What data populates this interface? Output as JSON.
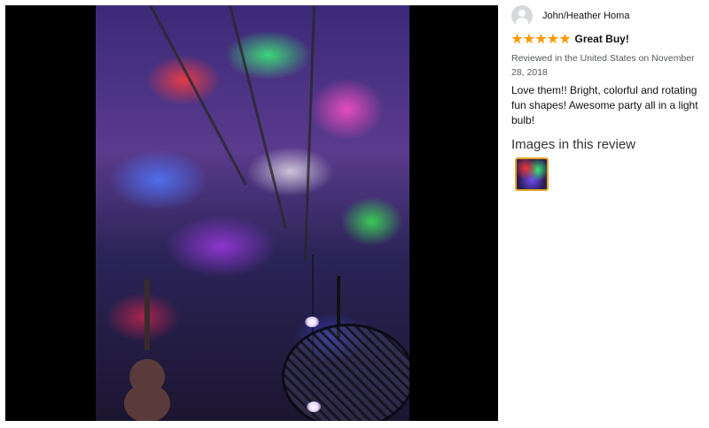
{
  "review": {
    "author": "John/Heather Homa",
    "rating": 5,
    "rating_max": 5,
    "headline": "Great Buy!",
    "meta": "Reviewed in the United States on November 28, 2018",
    "body": "Love them!! Bright, colorful and rotating fun shapes! Awesome party all in a light bulb!",
    "images_heading": "Images in this review",
    "icons": {
      "avatar": "default-user-avatar-icon",
      "star": "star-icon"
    },
    "colors": {
      "star": "#ff9900",
      "thumbnail_border": "#e4a82b",
      "meta_text": "#565959"
    }
  },
  "viewer": {
    "background": "#000000"
  }
}
